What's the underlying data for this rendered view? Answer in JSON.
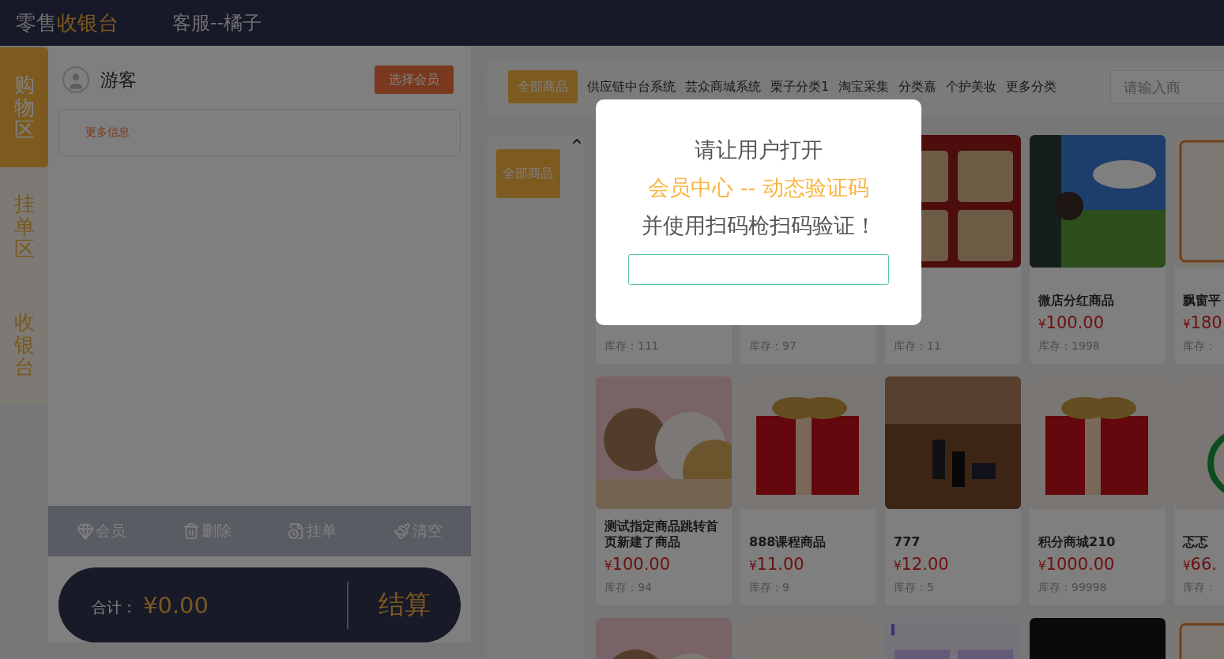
{
  "header": {
    "brand": "零售",
    "brand_highlight": "收银台",
    "user": "客服--橘子"
  },
  "side_tabs": [
    {
      "label": "购物区",
      "selected": true
    },
    {
      "label": "挂单区",
      "selected": false
    },
    {
      "label": "收银台",
      "selected": false
    }
  ],
  "member": {
    "name": "游客",
    "button": "选择会员",
    "more_info": "更多信息"
  },
  "actions": [
    {
      "kind": "member",
      "label": "会员"
    },
    {
      "kind": "delete",
      "label": "删除"
    },
    {
      "kind": "hold",
      "label": "挂单"
    },
    {
      "kind": "clear",
      "label": "清空"
    }
  ],
  "checkout": {
    "label": "合计：",
    "amount": "¥0.00",
    "button": "结算"
  },
  "categories": [
    {
      "label": "全部商品",
      "selected": true
    },
    {
      "label": "供应链中台系统",
      "selected": false
    },
    {
      "label": "芸众商城系统",
      "selected": false
    },
    {
      "label": "栗子分类1",
      "selected": false
    },
    {
      "label": "淘宝采集",
      "selected": false
    },
    {
      "label": "分类嘉",
      "selected": false
    },
    {
      "label": "个护美妆",
      "selected": false
    },
    {
      "label": "更多分类",
      "selected": false
    }
  ],
  "search": {
    "placeholder": "请输入商"
  },
  "side_categories": [
    {
      "label": "全部商品",
      "selected": true
    }
  ],
  "products": [
    {
      "stock": "库存：111"
    },
    {
      "stock": "库存：97"
    },
    {
      "stock": "库存：11"
    },
    {
      "name": "微店分红商品",
      "currency": "¥",
      "price": "100.00",
      "stock": "库存：1998"
    },
    {
      "name": "飘窗平",
      "currency": "¥",
      "price": "180",
      "stock": "库存："
    },
    {
      "name": "测试指定商品跳转首页新建了商品",
      "currency": "¥",
      "price": "100.00",
      "stock": "库存：94"
    },
    {
      "name": "888课程商品",
      "currency": "¥",
      "price": "11.00",
      "stock": "库存：9"
    },
    {
      "name": "777",
      "currency": "¥",
      "price": "12.00",
      "stock": "库存：5"
    },
    {
      "name": "积分商城210",
      "currency": "¥",
      "price": "1000.00",
      "stock": "库存：99998"
    },
    {
      "name": "忑忑",
      "currency": "¥",
      "price": "66.",
      "stock": "库存："
    },
    {
      "kind": "picture"
    },
    {
      "kind": "picture"
    },
    {
      "kind": "picture"
    },
    {
      "kind": "picture"
    },
    {
      "kind": "picture"
    }
  ],
  "modal": {
    "line1": "请让用户打开",
    "line2": "会员中心 -- 动态验证码",
    "line3": "并使用扫码枪扫码验证！"
  }
}
